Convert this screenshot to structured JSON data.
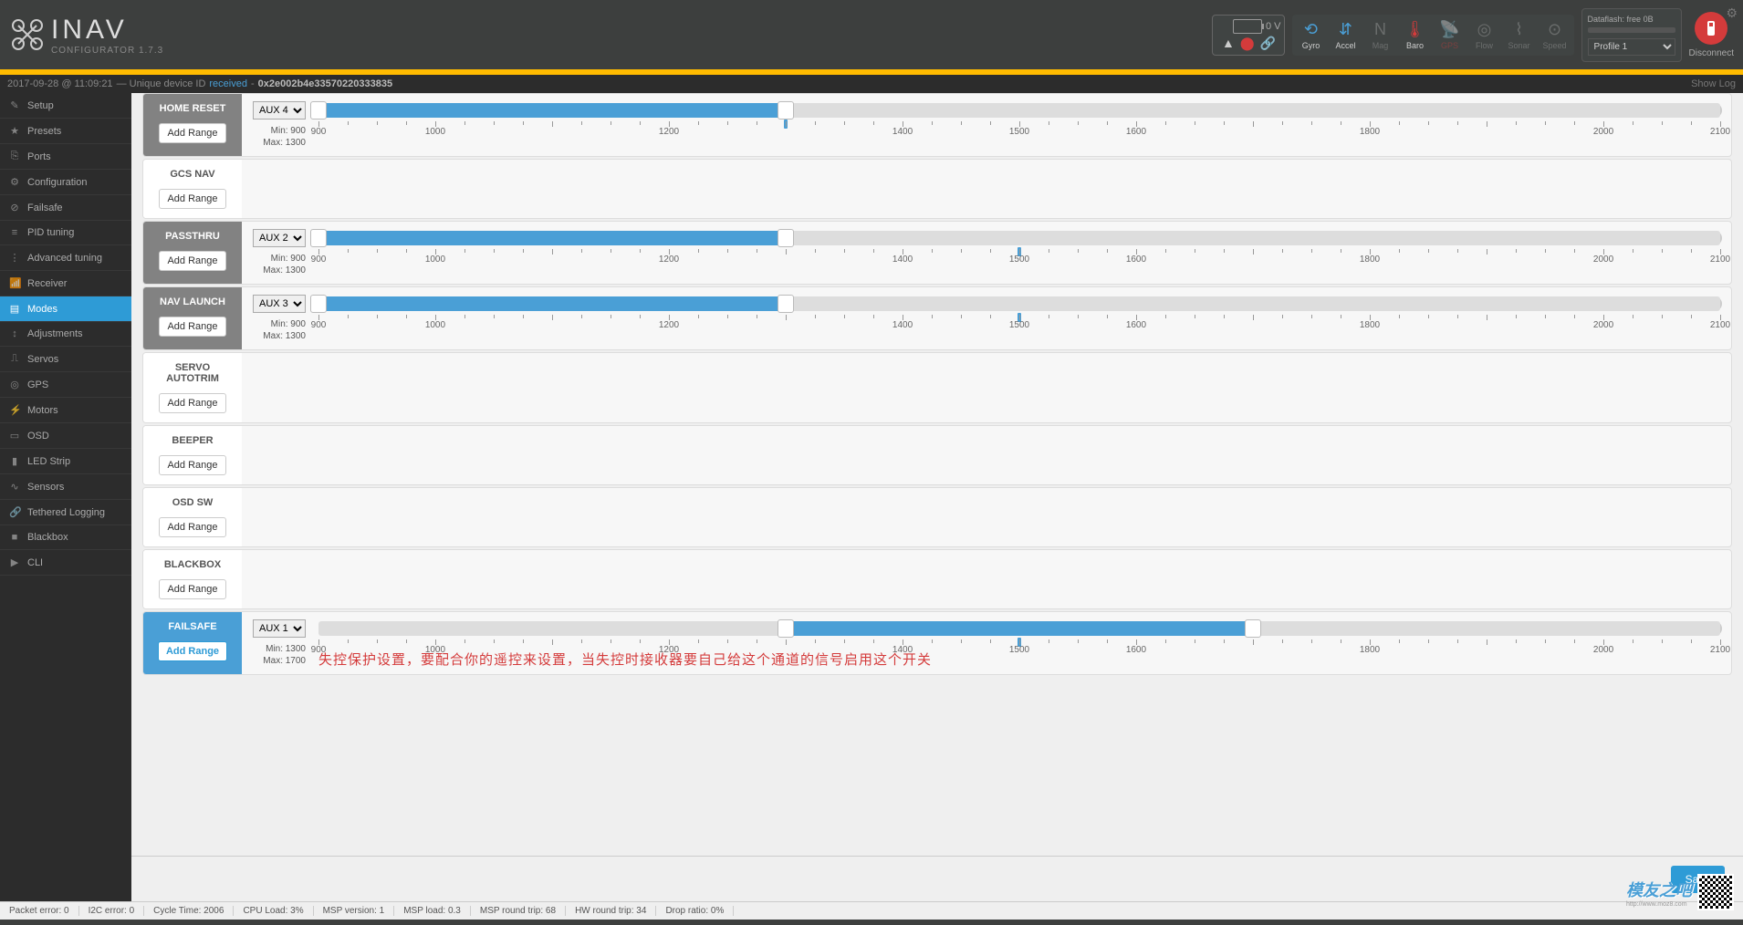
{
  "app": {
    "name": "INAV",
    "sub": "CONFIGURATOR  1.7.3"
  },
  "header": {
    "battery_voltage": "0 V",
    "sensors": [
      {
        "id": "gyro",
        "label": "Gyro"
      },
      {
        "id": "accel",
        "label": "Accel"
      },
      {
        "id": "mag",
        "label": "Mag"
      },
      {
        "id": "baro",
        "label": "Baro"
      },
      {
        "id": "gps",
        "label": "GPS"
      },
      {
        "id": "flow",
        "label": "Flow"
      },
      {
        "id": "sonar",
        "label": "Sonar"
      },
      {
        "id": "speed",
        "label": "Speed"
      }
    ],
    "dataflash": "Dataflash: free 0B",
    "profile": "Profile 1",
    "disconnect": "Disconnect"
  },
  "log": {
    "timestamp": "2017-09-28 @ 11:09:21",
    "sep": "— Unique device ID",
    "received": "received",
    "dash": "-",
    "hex": "0x2e002b4e33570220333835",
    "show_log": "Show Log"
  },
  "sidebar": {
    "items": [
      {
        "label": "Setup",
        "icon": "✎"
      },
      {
        "label": "Presets",
        "icon": "★"
      },
      {
        "label": "Ports",
        "icon": "⎘"
      },
      {
        "label": "Configuration",
        "icon": "⚙"
      },
      {
        "label": "Failsafe",
        "icon": "⊘"
      },
      {
        "label": "PID tuning",
        "icon": "≡"
      },
      {
        "label": "Advanced tuning",
        "icon": "⋮"
      },
      {
        "label": "Receiver",
        "icon": "📶"
      },
      {
        "label": "Modes",
        "icon": "▤"
      },
      {
        "label": "Adjustments",
        "icon": "↕"
      },
      {
        "label": "Servos",
        "icon": "⎍"
      },
      {
        "label": "GPS",
        "icon": "◎"
      },
      {
        "label": "Motors",
        "icon": "⚡"
      },
      {
        "label": "OSD",
        "icon": "▭"
      },
      {
        "label": "LED Strip",
        "icon": "▮"
      },
      {
        "label": "Sensors",
        "icon": "∿"
      },
      {
        "label": "Tethered Logging",
        "icon": "🔗"
      },
      {
        "label": "Blackbox",
        "icon": "■"
      },
      {
        "label": "CLI",
        "icon": "▶"
      }
    ],
    "active": 8
  },
  "modes": {
    "add_range": "Add Range",
    "tick_labels": [
      "900",
      "1000",
      "1200",
      "1400",
      "1500",
      "1600",
      "1800",
      "2000",
      "2100"
    ],
    "tick_positions": [
      0,
      8.33,
      25,
      41.67,
      50,
      58.33,
      75,
      91.67,
      100
    ],
    "rows": [
      {
        "name": "HOME RESET",
        "aux": "AUX 4",
        "min": "Min: 900",
        "max": "Max: 1300",
        "range_lo": 900,
        "range_hi": 1300,
        "marker": 1300,
        "active": false,
        "has_range": true
      },
      {
        "name": "GCS NAV",
        "has_range": false
      },
      {
        "name": "PASSTHRU",
        "aux": "AUX 2",
        "min": "Min: 900",
        "max": "Max: 1300",
        "range_lo": 900,
        "range_hi": 1300,
        "marker": 1500,
        "active": false,
        "has_range": true
      },
      {
        "name": "NAV LAUNCH",
        "aux": "AUX 3",
        "min": "Min: 900",
        "max": "Max: 1300",
        "range_lo": 900,
        "range_hi": 1300,
        "marker": 1500,
        "active": false,
        "has_range": true
      },
      {
        "name": "SERVO AUTOTRIM",
        "has_range": false
      },
      {
        "name": "BEEPER",
        "has_range": false
      },
      {
        "name": "OSD SW",
        "has_range": false
      },
      {
        "name": "BLACKBOX",
        "has_range": false
      },
      {
        "name": "FAILSAFE",
        "aux": "AUX 1",
        "min": "Min: 1300",
        "max": "Max: 1700",
        "range_lo": 1300,
        "range_hi": 1700,
        "marker": 1500,
        "active": true,
        "has_range": true,
        "annotation": "失控保护设置，要配合你的遥控来设置，当失控时接收器要自己给这个通道的信号启用这个开关"
      }
    ]
  },
  "buttons": {
    "save": "Save"
  },
  "statusbar": [
    "Packet error: 0",
    "I2C error: 0",
    "Cycle Time: 2006",
    "CPU Load: 3%",
    "MSP version: 1",
    "MSP load: 0.3",
    "MSP round trip: 68",
    "HW round trip: 34",
    "Drop ratio: 0%"
  ],
  "watermark": {
    "text": "模友之吧",
    "sub": "http://www.moz8.com"
  }
}
